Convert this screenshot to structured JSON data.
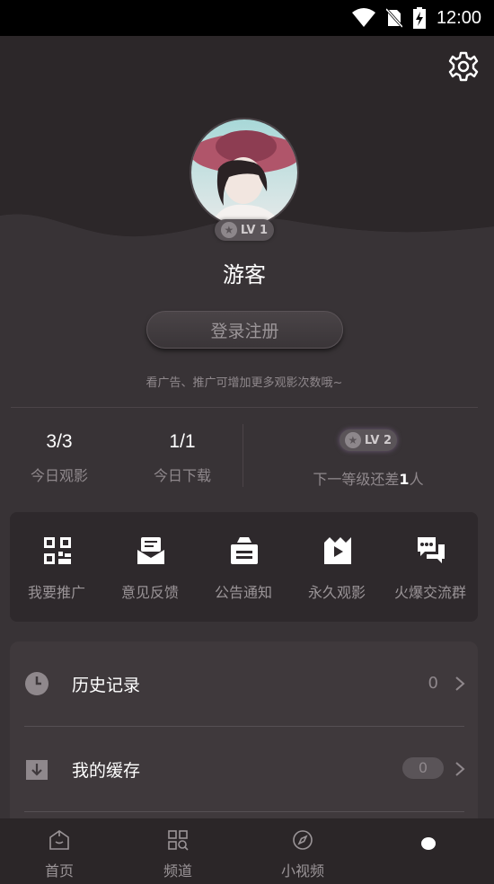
{
  "status_bar": {
    "time": "12:00"
  },
  "profile": {
    "username": "游客",
    "level_badge": "LV 1",
    "login_button": "登录注册",
    "ad_hint": "看广告、推广可增加更多观影次数哦~"
  },
  "stats": [
    {
      "value": "3/3",
      "label": "今日观影"
    },
    {
      "value": "1/1",
      "label": "今日下载"
    }
  ],
  "next_level": {
    "badge": "LV 2",
    "text_prefix": "下一等级还差",
    "count": "1",
    "text_suffix": "人"
  },
  "shortcuts": [
    {
      "label": "我要推广",
      "icon": "qr-code-icon"
    },
    {
      "label": "意见反馈",
      "icon": "feedback-icon"
    },
    {
      "label": "公告通知",
      "icon": "announcement-icon"
    },
    {
      "label": "永久观影",
      "icon": "video-icon"
    },
    {
      "label": "火爆交流群",
      "icon": "chat-group-icon"
    }
  ],
  "menu": [
    {
      "label": "历史记录",
      "count": "0",
      "icon": "clock-icon"
    },
    {
      "label": "我的缓存",
      "count": "0",
      "icon": "download-icon"
    }
  ],
  "tabs": [
    {
      "label": "首页",
      "icon": "home-icon"
    },
    {
      "label": "频道",
      "icon": "grid-icon"
    },
    {
      "label": "小视频",
      "icon": "compass-icon"
    }
  ],
  "colors": {
    "background": "#383336",
    "header": "#2c2729",
    "card": "#3f393c",
    "muted_text": "#8f888c"
  }
}
